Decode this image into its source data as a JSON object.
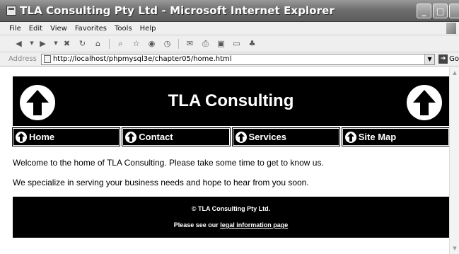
{
  "window": {
    "title": "TLA Consulting Pty Ltd - Microsoft Internet Explorer",
    "minimize": "_",
    "maximize": "□",
    "close": "✕"
  },
  "menubar": {
    "items": [
      "File",
      "Edit",
      "View",
      "Favorites",
      "Tools",
      "Help"
    ]
  },
  "toolbar": {
    "icons": [
      "back-icon",
      "back-dropdown-icon",
      "forward-icon",
      "forward-dropdown-icon",
      "stop-icon",
      "refresh-icon",
      "home-icon",
      "search-icon",
      "favorites-icon",
      "media-icon",
      "history-icon",
      "mail-icon",
      "print-icon",
      "edit-icon",
      "discuss-icon",
      "messenger-icon"
    ]
  },
  "addressbar": {
    "label": "Address",
    "url": "http://localhost/phpmysql3e/chapter05/home.html",
    "go": "Go"
  },
  "page": {
    "site_title": "TLA Consulting",
    "nav": [
      {
        "label": "Home"
      },
      {
        "label": "Contact"
      },
      {
        "label": "Services"
      },
      {
        "label": "Site Map"
      }
    ],
    "intro": "Welcome to the home of TLA Consulting. Please take some time to get to know us.",
    "specialize": "We specialize in serving your business needs and hope to hear from you soon.",
    "footer": {
      "copyright": "© TLA Consulting Pty Ltd.",
      "legal_prefix": "Please see our",
      "legal_link": "legal information page"
    }
  }
}
